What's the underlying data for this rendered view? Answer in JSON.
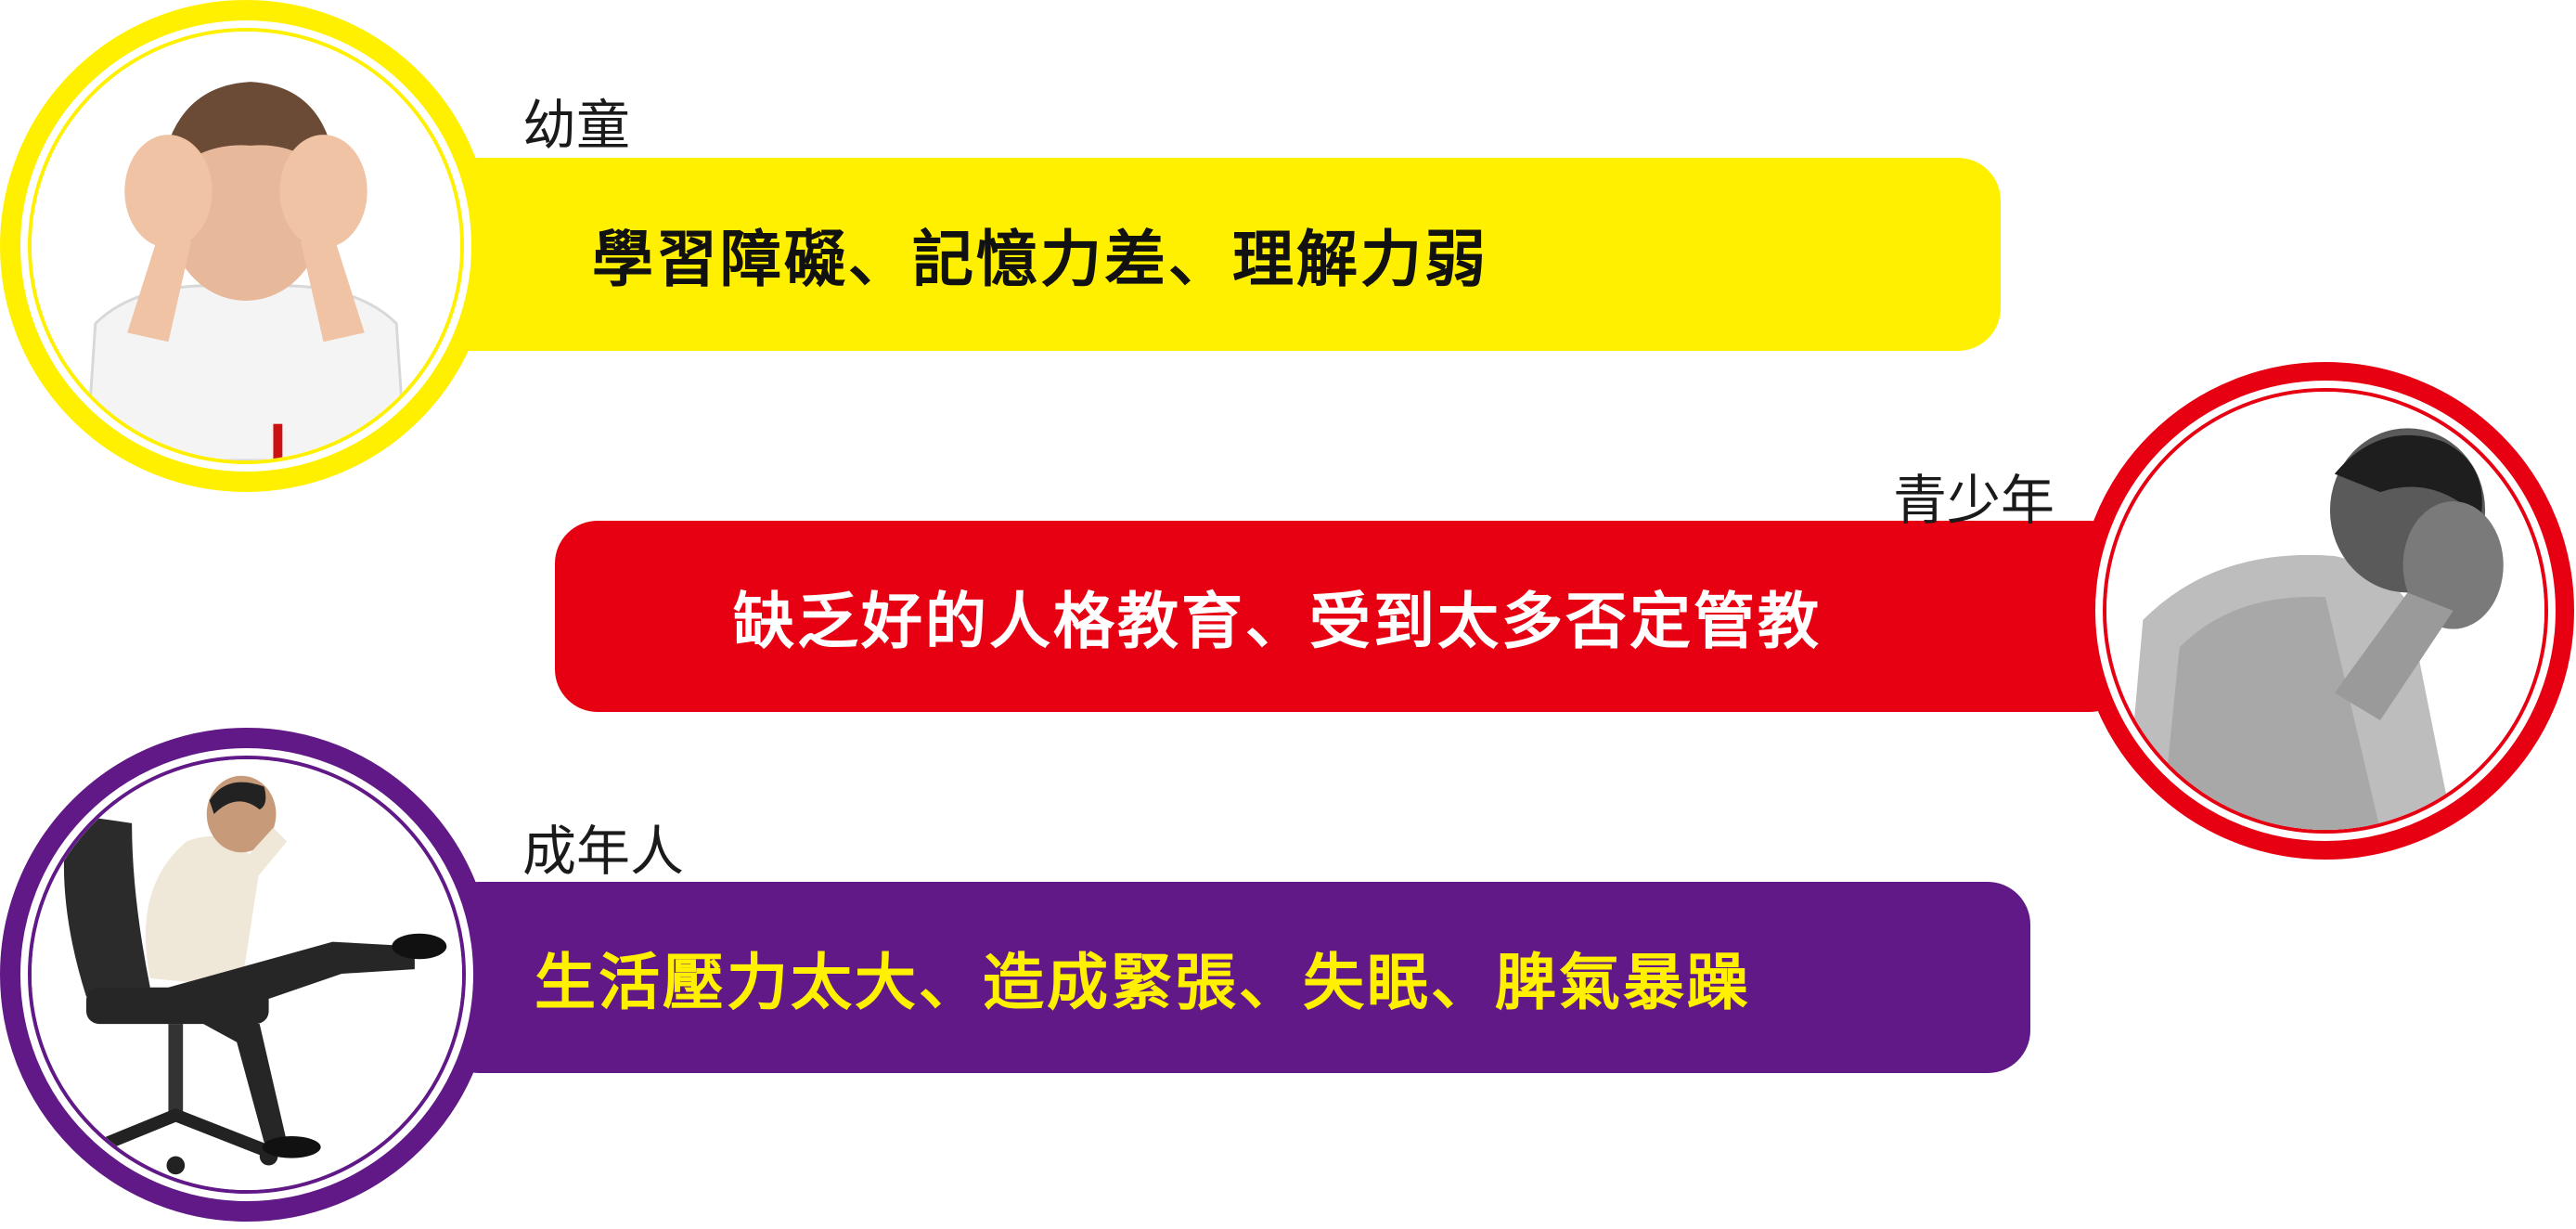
{
  "groups": [
    {
      "label": "幼童",
      "text": "學習障礙、記憶力差、理解力弱",
      "banner_color": "#fff000",
      "text_color": "#111111",
      "ring_color": "#fff000",
      "photo_icon": "child-holding-head-icon"
    },
    {
      "label": "青少年",
      "text": "缺乏好的人格教育、受到太多否定管教",
      "banner_color": "#e60012",
      "text_color": "#ffffff",
      "ring_color": "#e60012",
      "photo_icon": "teen-face-in-hands-icon"
    },
    {
      "label": "成年人",
      "text": "生活壓力太大、造成緊張、失眠、脾氣暴躁",
      "banner_color": "#601986",
      "text_color": "#fff000",
      "ring_color": "#601986",
      "photo_icon": "stressed-man-on-chair-icon"
    }
  ]
}
